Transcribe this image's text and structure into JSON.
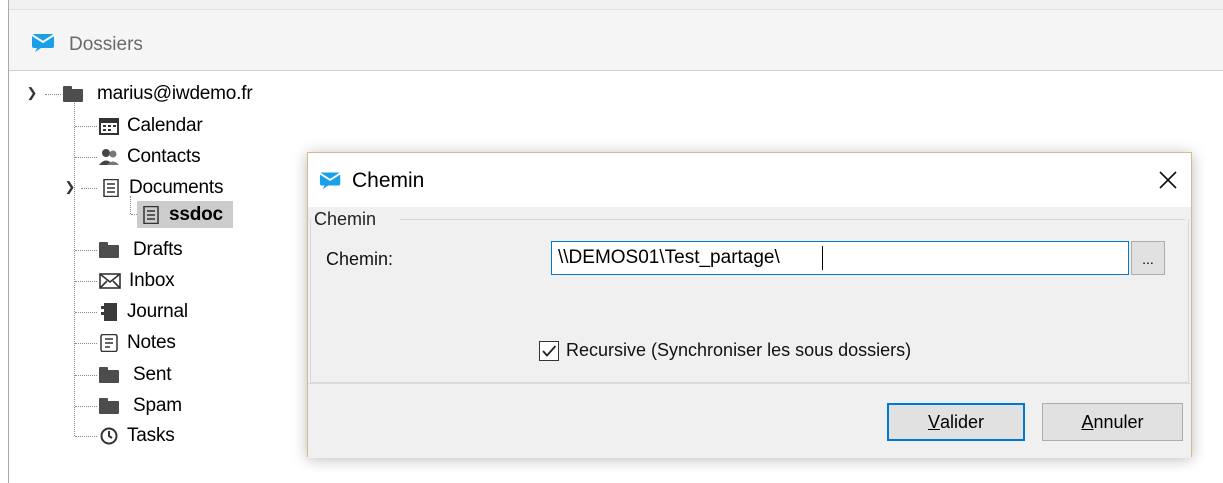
{
  "window": {
    "title": "Dossiers",
    "icon": "app-envelope-icon"
  },
  "tree": {
    "account": {
      "label": "marius@iwdemo.fr",
      "icon": "folder-icon",
      "expanded": true
    },
    "folders": [
      {
        "label": "Calendar",
        "icon": "calendar-icon"
      },
      {
        "label": "Contacts",
        "icon": "contacts-icon"
      },
      {
        "label": "Documents",
        "icon": "document-icon",
        "expanded": true
      },
      {
        "label": "ssdoc",
        "icon": "document-icon",
        "selected": true
      },
      {
        "label": "Drafts",
        "icon": "folder-icon"
      },
      {
        "label": "Inbox",
        "icon": "mail-icon"
      },
      {
        "label": "Journal",
        "icon": "journal-icon"
      },
      {
        "label": "Notes",
        "icon": "notes-icon"
      },
      {
        "label": "Sent",
        "icon": "folder-icon"
      },
      {
        "label": "Spam",
        "icon": "folder-icon"
      },
      {
        "label": "Tasks",
        "icon": "clock-icon"
      }
    ]
  },
  "dialog": {
    "title": "Chemin",
    "group_label": "Chemin",
    "field_label": "Chemin:",
    "path_value": "\\\\DEMOS01\\Test_partage\\",
    "browse_label": "...",
    "recursive_label": "Recursive (Synchroniser les sous dossiers)",
    "recursive_checked": true,
    "ok_mnemonic": "V",
    "ok_rest": "alider",
    "cancel_mnemonic": "A",
    "cancel_rest": "nnuler"
  },
  "colors": {
    "accent": "#0078d7",
    "app_icon": "#1aa0e8",
    "selection": "#cccccc",
    "dialog_border": "#d7b98a"
  }
}
